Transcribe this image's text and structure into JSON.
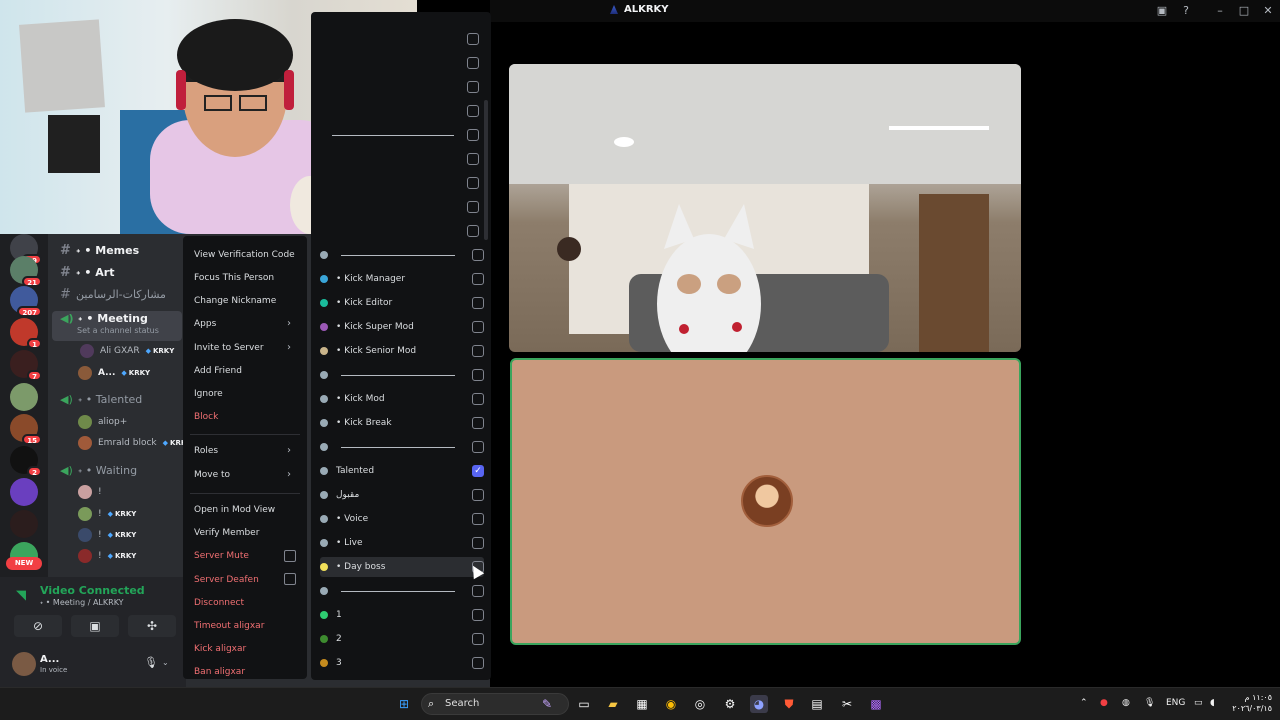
{
  "window": {
    "title": "ALKRKY"
  },
  "discord": {
    "servers": [
      {
        "badge": "99"
      },
      {
        "badge": "21"
      },
      {
        "badge": "207"
      },
      {
        "badge": "1"
      },
      {
        "badge": "7"
      },
      {
        "badge": ""
      },
      {
        "badge": "15"
      },
      {
        "badge": "2"
      },
      {
        "badge": ""
      },
      {
        "badge": ""
      }
    ],
    "new_badge": "NEW",
    "channels": {
      "memes": "˖ • Memes",
      "art": "˖ • Art",
      "arabic_channel": "مشاركات-الرسامين",
      "meeting": "˖ • Meeting",
      "meeting_status": "Set a channel status",
      "talented": "˖ • Talented",
      "waiting": "˖ • Waiting"
    },
    "members": {
      "meeting": [
        {
          "name": "Ali GXAR",
          "tag": "KRKY"
        },
        {
          "name": "A...",
          "tag": "KRKY"
        }
      ],
      "talented": [
        {
          "name": "aliop+",
          "tag": ""
        },
        {
          "name": "Emrald block",
          "tag": "KRK"
        }
      ],
      "waiting": [
        {
          "name": "!",
          "tag": ""
        },
        {
          "name": "!",
          "tag": "KRKY"
        },
        {
          "name": "!",
          "tag": "KRKY"
        },
        {
          "name": "!",
          "tag": "KRKY"
        }
      ]
    },
    "voice_panel": {
      "title": "Video Connected",
      "subtitle": "˖ • Meeting / ALKRKY",
      "user_name": "A...",
      "user_status": "In voice"
    }
  },
  "context_menu": {
    "items": [
      "View Verification Code",
      "Focus This Person",
      "Change Nickname",
      "Apps",
      "Invite to Server",
      "Add Friend",
      "Ignore",
      "Block",
      "Roles",
      "Move to",
      "Open in Mod View",
      "Verify Member",
      "Server Mute",
      "Server Deafen",
      "Disconnect",
      "Timeout aligxar",
      "Kick aligxar",
      "Ban aligxar"
    ]
  },
  "roles": [
    {
      "name": "",
      "color": "#99aab5",
      "divider": true,
      "checked": false
    },
    {
      "name": "• Kick Manager",
      "color": "#3aa5d8",
      "divider": false,
      "checked": false
    },
    {
      "name": "• Kick Editor",
      "color": "#1abc9c",
      "divider": false,
      "checked": false
    },
    {
      "name": "• Kick Super Mod",
      "color": "#9b59b6",
      "divider": false,
      "checked": false
    },
    {
      "name": "• Kick Senior Mod",
      "color": "#c9b48a",
      "divider": false,
      "checked": false
    },
    {
      "name": "",
      "color": "#99aab5",
      "divider": true,
      "checked": false
    },
    {
      "name": "• Kick Mod",
      "color": "#99aab5",
      "divider": false,
      "checked": false
    },
    {
      "name": "• Kick Break",
      "color": "#99aab5",
      "divider": false,
      "checked": false
    },
    {
      "name": "",
      "color": "#99aab5",
      "divider": true,
      "checked": false
    },
    {
      "name": "Talented",
      "color": "#99aab5",
      "divider": false,
      "checked": true
    },
    {
      "name": "مقبول",
      "color": "#99aab5",
      "divider": false,
      "checked": false
    },
    {
      "name": "• Voice",
      "color": "#99aab5",
      "divider": false,
      "checked": false
    },
    {
      "name": "• Live",
      "color": "#99aab5",
      "divider": false,
      "checked": false
    },
    {
      "name": "• Day boss",
      "color": "#f1e05a",
      "divider": false,
      "checked": false
    },
    {
      "name": "",
      "color": "#99aab5",
      "divider": true,
      "checked": false
    },
    {
      "name": "1",
      "color": "#2ecc71",
      "divider": false,
      "checked": false
    },
    {
      "name": "2",
      "color": "#3d8b2f",
      "divider": false,
      "checked": false
    },
    {
      "name": "3",
      "color": "#c58b1e",
      "divider": false,
      "checked": false
    }
  ],
  "taskbar": {
    "search_placeholder": "Search",
    "lang": "ENG",
    "time": "١١:٠٥ م",
    "date": "٢٠٢٦/٠٣/١٥"
  }
}
